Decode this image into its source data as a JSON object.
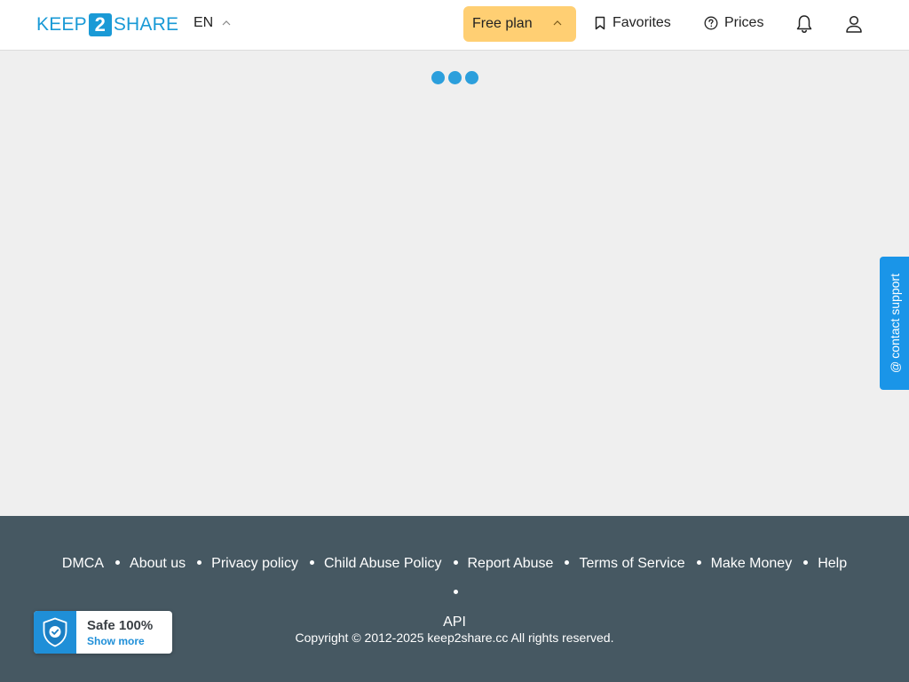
{
  "header": {
    "logo": {
      "part1": "KEEP",
      "part2": "2",
      "part3": "SHARE"
    },
    "language": "EN",
    "plan_label": "Free plan",
    "favorites_label": "Favorites",
    "prices_label": "Prices",
    "icons": {
      "chevron": "chevron-up-icon",
      "bookmark": "bookmark-icon",
      "help": "help-circle-icon",
      "bell": "bell-icon",
      "user": "user-icon"
    }
  },
  "loader": {
    "dots": 3,
    "color": "#2c9fdc"
  },
  "support": {
    "label": "contact support",
    "icon": "at-icon"
  },
  "footer": {
    "links": [
      "DMCA",
      "About us",
      "Privacy policy",
      "Child Abuse Policy",
      "Report Abuse",
      "Terms of Service",
      "Make Money",
      "Help",
      "API"
    ],
    "copyright": "Copyright © 2012-2025 keep2share.cc All rights reserved."
  },
  "safe_badge": {
    "title": "Safe 100%",
    "subtitle": "Show more",
    "icon": "shield-check-icon"
  },
  "colors": {
    "brand": "#1a9ad6",
    "plan": "#ffcf73",
    "footer": "#465862",
    "support": "#1a95e8",
    "page_bg": "#efefef"
  }
}
